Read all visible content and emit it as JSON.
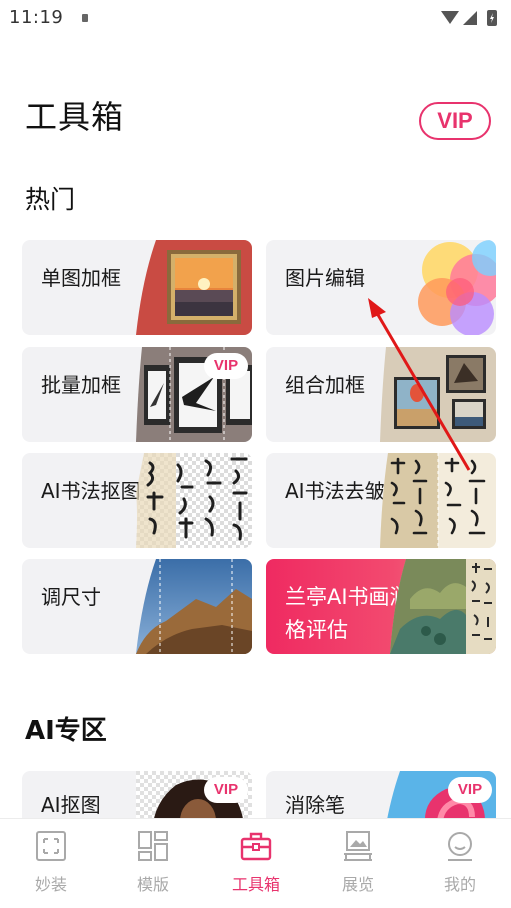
{
  "status_bar": {
    "time": "11:19"
  },
  "header": {
    "title": "工具箱",
    "vip": "VIP"
  },
  "sections": {
    "hot": "热门",
    "ai_zone": "AI专区"
  },
  "cards": [
    {
      "label": "单图加框"
    },
    {
      "label": "图片编辑"
    },
    {
      "label": "批量加框",
      "badge": "VIP"
    },
    {
      "label": "组合加框"
    },
    {
      "label": "AI书法抠图"
    },
    {
      "label": "AI书法去皱"
    },
    {
      "label": "调尺寸"
    },
    {
      "label": "兰亭AI书画润格评估"
    }
  ],
  "ai_cards": [
    {
      "label": "AI抠图",
      "badge": "VIP"
    },
    {
      "label": "消除笔",
      "badge": "VIP"
    }
  ],
  "nav": [
    {
      "label": "妙装",
      "icon": "frame-icon"
    },
    {
      "label": "模版",
      "icon": "template-icon"
    },
    {
      "label": "工具箱",
      "icon": "toolbox-icon",
      "active": true
    },
    {
      "label": "展览",
      "icon": "exhibition-icon"
    },
    {
      "label": "我的",
      "icon": "profile-icon"
    }
  ],
  "colors": {
    "accent": "#e8336d",
    "card_bg": "#f2f2f4",
    "nav_inactive": "#a9a9a9",
    "arrow": "#e01818"
  }
}
